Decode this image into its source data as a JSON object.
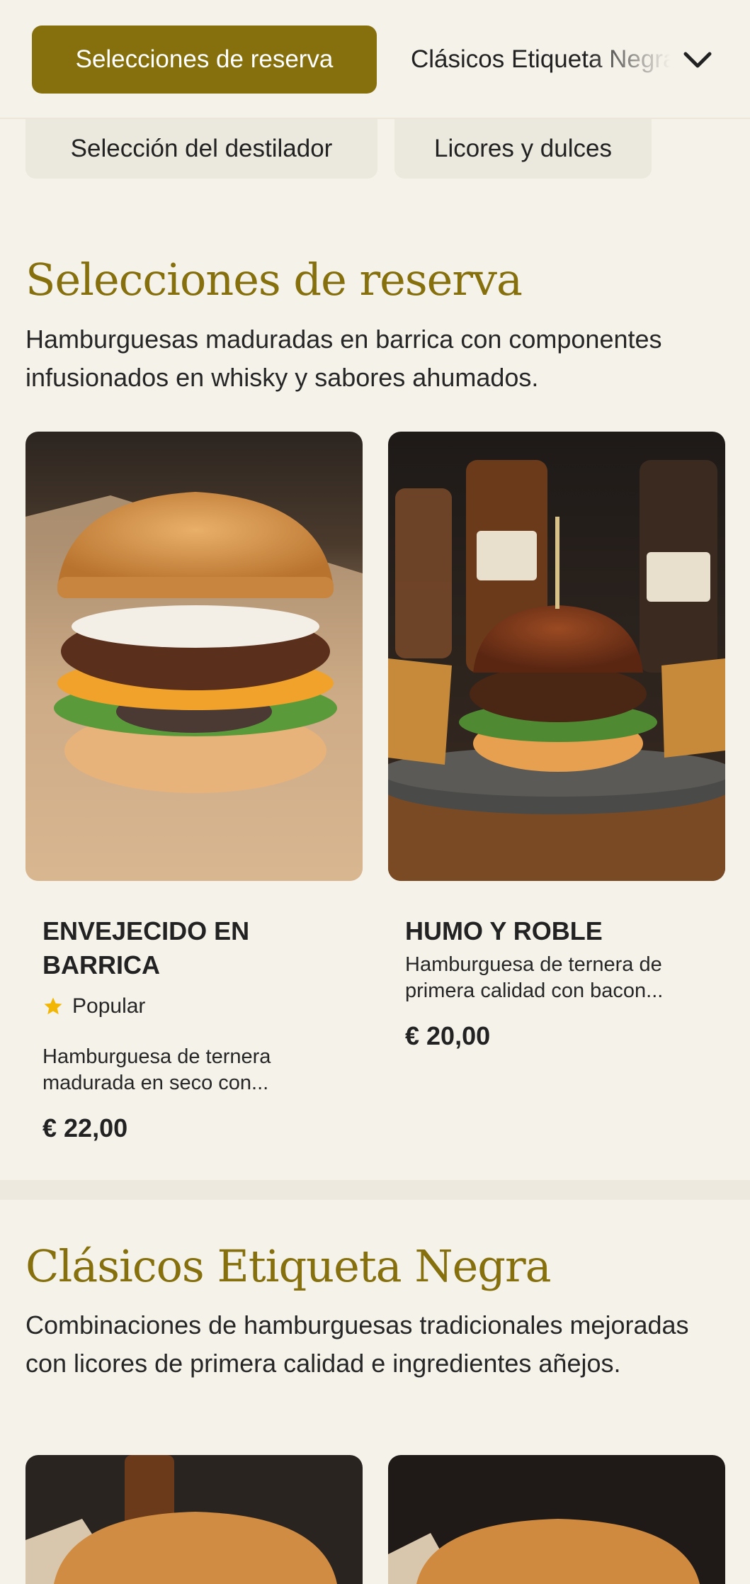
{
  "categories": {
    "active": "Selecciones de reserva",
    "next": "Clásicos Etiqueta Negra",
    "sub_items": [
      "Selección del destilador",
      "Licores y dulces"
    ]
  },
  "sections": [
    {
      "title": "Selecciones de reserva",
      "description": "Hamburguesas maduradas en barrica con componentes infusionados en whisky y sabores ahumados.",
      "items": [
        {
          "name": "ENVEJECIDO EN BARRICA",
          "badge": "Popular",
          "description": "Hamburguesa de ternera madurada en seco con...",
          "price": "€ 22,00"
        },
        {
          "name": "HUMO Y ROBLE",
          "description": "Hamburguesa de ternera de primera calidad con bacon...",
          "price": "€ 20,00"
        }
      ]
    },
    {
      "title": "Clásicos Etiqueta Negra",
      "description": "Combinaciones de hamburguesas tradicionales mejoradas con licores de primera calidad e ingredientes añejos."
    }
  ],
  "colors": {
    "accent": "#86700d",
    "background": "#f5f2ea",
    "star": "#f2b705"
  },
  "icons": {
    "category_toggle": "chevron-down-icon",
    "badge": "star-icon"
  }
}
